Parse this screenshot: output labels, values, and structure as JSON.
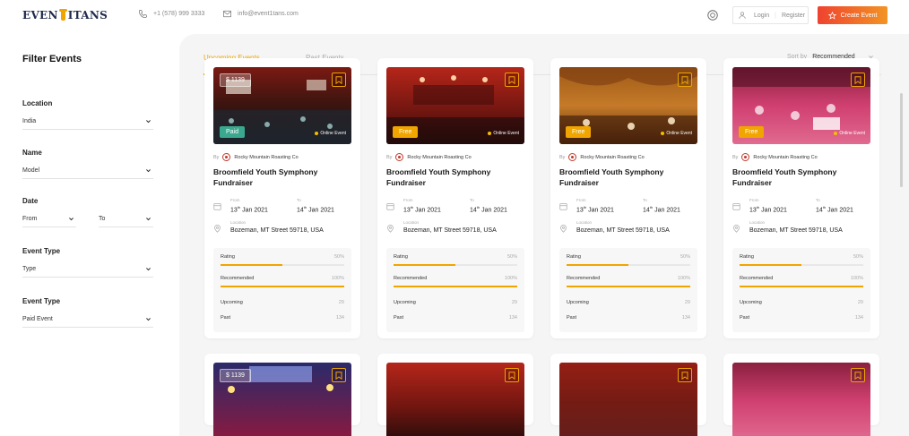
{
  "header": {
    "logo_left": "EVEN",
    "logo_right": "ITANS",
    "phone": "+1 (578) 999 3333",
    "email": "info@event1tans.com",
    "login": "Login",
    "register": "Register",
    "create_event": "Create Event"
  },
  "sidebar": {
    "title": "Filter Events",
    "location_label": "Location",
    "location_value": "India",
    "name_label": "Name",
    "name_value": "Model",
    "date_label": "Date",
    "date_from": "From",
    "date_to": "To",
    "event_type_label_1": "Event Type",
    "event_type_value_1": "Type",
    "event_type_label_2": "Event Type",
    "event_type_value_2": "Paid Event"
  },
  "main": {
    "tab_upcoming": "Upcoming Events",
    "tab_past": "Past Events",
    "sort_label": "Sort by",
    "sort_value": "Recommended"
  },
  "cards": [
    {
      "price": "$ 1139",
      "badge": "Paid",
      "online": "Online Event",
      "by": "By",
      "organizer": "Rocky Mountain Roasting Co",
      "title": "Broomfield Youth Symphony Fundraiser",
      "from_label": "From",
      "from_day": "13",
      "from_sup": "th",
      "from_rest": " Jan 2021",
      "to_label": "To",
      "to_day": "14",
      "to_sup": "th",
      "to_rest": " Jan 2021",
      "location_label": "Location",
      "location": "Bozeman, MT Street 59718, USA",
      "rating_label": "Rating",
      "rating": "50%",
      "rating_pct": 50,
      "recommended_label": "Recommended",
      "recommended": "100%",
      "recommended_pct": 100,
      "upcoming_label": "Upcoming",
      "upcoming": "29",
      "past_label": "Past",
      "past": "134"
    },
    {
      "badge": "Free",
      "online": "Online Event",
      "by": "By",
      "organizer": "Rocky Mountain Roasting Co",
      "title": "Broomfield Youth Symphony Fundraiser",
      "from_label": "From",
      "from_day": "13",
      "from_sup": "th",
      "from_rest": " Jan 2021",
      "to_label": "To",
      "to_day": "14",
      "to_sup": "th",
      "to_rest": " Jan 2021",
      "location_label": "Location",
      "location": "Bozeman, MT Street 59718, USA",
      "rating_label": "Rating",
      "rating": "50%",
      "rating_pct": 50,
      "recommended_label": "Recommended",
      "recommended": "100%",
      "recommended_pct": 100,
      "upcoming_label": "Upcoming",
      "upcoming": "29",
      "past_label": "Past",
      "past": "134"
    },
    {
      "badge": "Free",
      "online": "Online Event",
      "by": "By",
      "organizer": "Rocky Mountain Roasting Co",
      "title": "Broomfield Youth Symphony Fundraiser",
      "from_label": "From",
      "from_day": "13",
      "from_sup": "th",
      "from_rest": " Jan 2021",
      "to_label": "To",
      "to_day": "14",
      "to_sup": "th",
      "to_rest": " Jan 2021",
      "location_label": "Location",
      "location": "Bozeman, MT Street 59718, USA",
      "rating_label": "Rating",
      "rating": "50%",
      "rating_pct": 50,
      "recommended_label": "Recommended",
      "recommended": "100%",
      "recommended_pct": 100,
      "upcoming_label": "Upcoming",
      "upcoming": "29",
      "past_label": "Past",
      "past": "134"
    },
    {
      "badge": "Free",
      "online": "Online Event",
      "by": "By",
      "organizer": "Rocky Mountain Roasting Co",
      "title": "Broomfield Youth Symphony Fundraiser",
      "from_label": "From",
      "from_day": "13",
      "from_sup": "th",
      "from_rest": " Jan 2021",
      "to_label": "To",
      "to_day": "14",
      "to_sup": "th",
      "to_rest": " Jan 2021",
      "location_label": "Location",
      "location": "Bozeman, MT Street 59718, USA",
      "rating_label": "Rating",
      "rating": "50%",
      "rating_pct": 50,
      "recommended_label": "Recommended",
      "recommended": "100%",
      "recommended_pct": 100,
      "upcoming_label": "Upcoming",
      "upcoming": "29",
      "past_label": "Past",
      "past": "134"
    }
  ],
  "bottom_cards": [
    {
      "price": "$ 1139"
    },
    {},
    {},
    {}
  ],
  "colors": {
    "accent": "#f0a500",
    "paid_badge": "#3aa88f",
    "create_start": "#ef4230",
    "create_end": "#f29423"
  }
}
